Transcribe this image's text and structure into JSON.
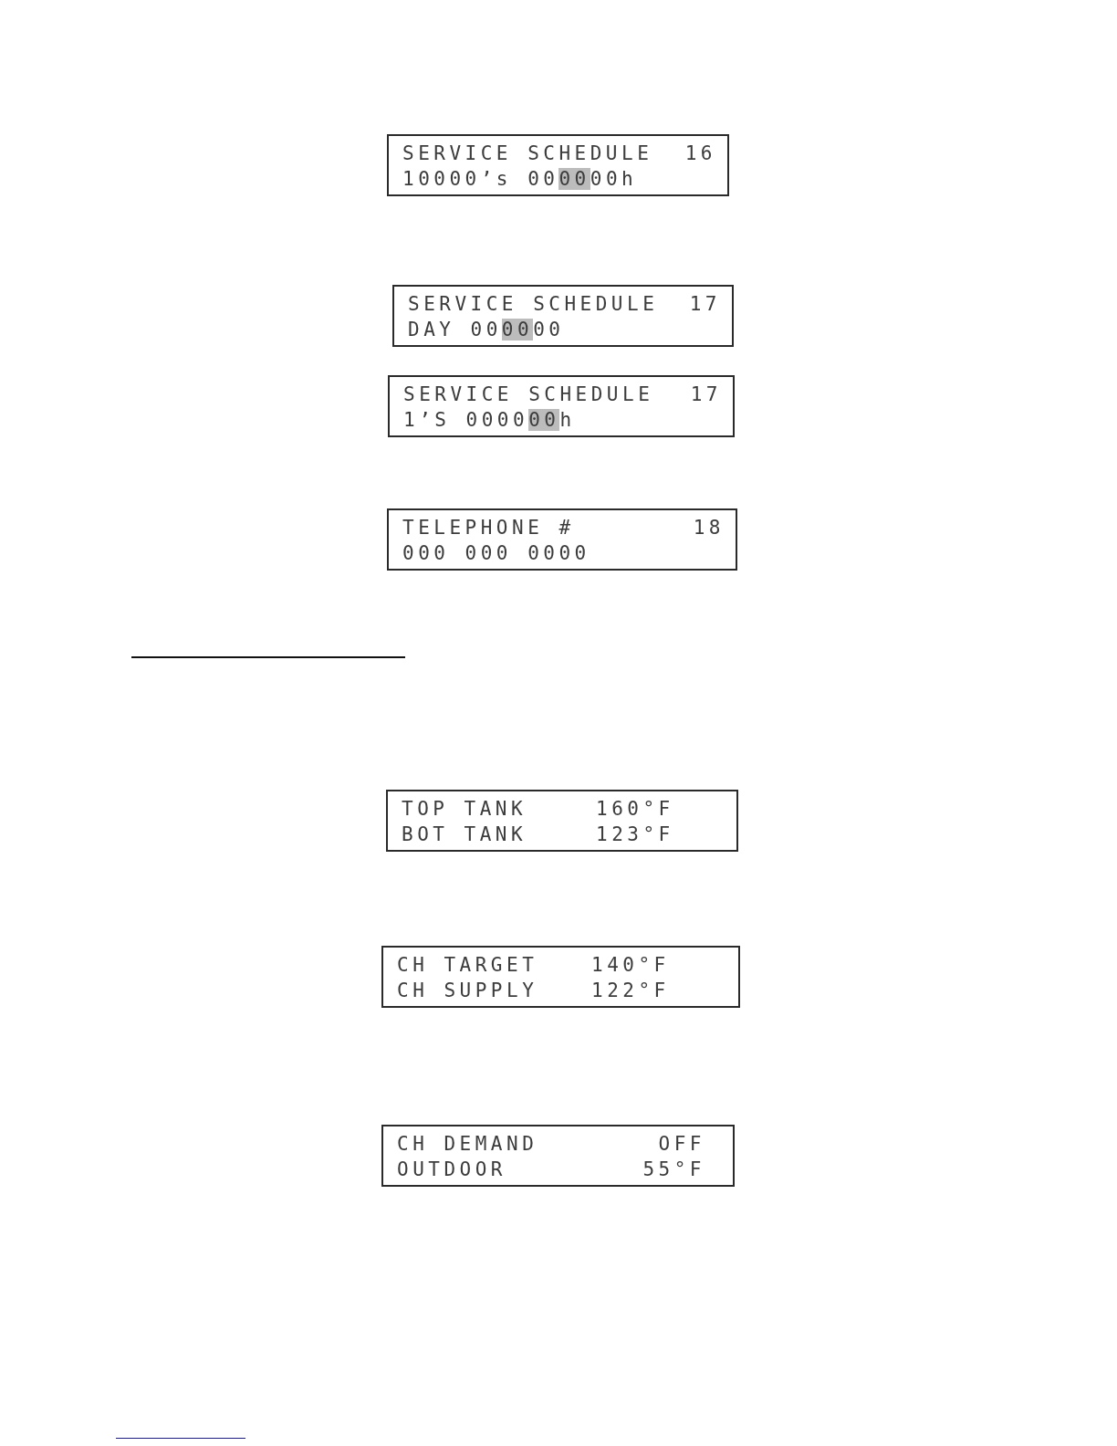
{
  "sections": [
    {
      "displays": [
        {
          "kind": "menu",
          "lines": [
            {
              "segments": [
                {
                  "text": "SERVICE SCHEDULE",
                  "cursor": false
                }
              ],
              "value": "16"
            },
            {
              "segments": [
                {
                  "text": "10000’s 00",
                  "cursor": false
                },
                {
                  "text": "00",
                  "cursor": true
                },
                {
                  "text": "00h",
                  "cursor": false
                }
              ]
            }
          ]
        },
        {
          "kind": "menu",
          "lines": [
            {
              "segments": [
                {
                  "text": "SERVICE SCHEDULE",
                  "cursor": false
                }
              ],
              "value": "17"
            },
            {
              "segments": [
                {
                  "text": "DAY 00",
                  "cursor": false
                },
                {
                  "text": "00",
                  "cursor": true
                },
                {
                  "text": "00",
                  "cursor": false
                }
              ]
            }
          ]
        },
        {
          "kind": "menu",
          "lines": [
            {
              "segments": [
                {
                  "text": "SERVICE SCHEDULE",
                  "cursor": false
                }
              ],
              "value": "17"
            },
            {
              "segments": [
                {
                  "text": "1’S 0000",
                  "cursor": false
                },
                {
                  "text": "00",
                  "cursor": true
                },
                {
                  "text": "h",
                  "cursor": false
                }
              ]
            }
          ]
        },
        {
          "kind": "menu",
          "lines": [
            {
              "segments": [
                {
                  "text": "TELEPHONE #",
                  "cursor": false
                }
              ],
              "value": "18"
            },
            {
              "segments": [
                {
                  "text": "000 000 0000",
                  "cursor": false
                }
              ]
            }
          ]
        }
      ]
    },
    {
      "displays": [
        {
          "kind": "reading",
          "lines": [
            {
              "segments": [
                {
                  "text": "TOP TANK",
                  "cursor": false
                }
              ],
              "value": "160°F"
            },
            {
              "segments": [
                {
                  "text": "BOT TANK",
                  "cursor": false
                }
              ],
              "value": "123°F"
            }
          ]
        },
        {
          "kind": "reading",
          "lines": [
            {
              "segments": [
                {
                  "text": "CH TARGET",
                  "cursor": false
                }
              ],
              "value": "140°F"
            },
            {
              "segments": [
                {
                  "text": "CH SUPPLY",
                  "cursor": false
                }
              ],
              "value": "122°F"
            }
          ]
        },
        {
          "kind": "status",
          "lines": [
            {
              "segments": [
                {
                  "text": "CH DEMAND",
                  "cursor": false
                }
              ],
              "value": "OFF"
            },
            {
              "segments": [
                {
                  "text": "OUTDOOR",
                  "cursor": false
                }
              ],
              "value": "55°F"
            }
          ]
        }
      ]
    }
  ]
}
